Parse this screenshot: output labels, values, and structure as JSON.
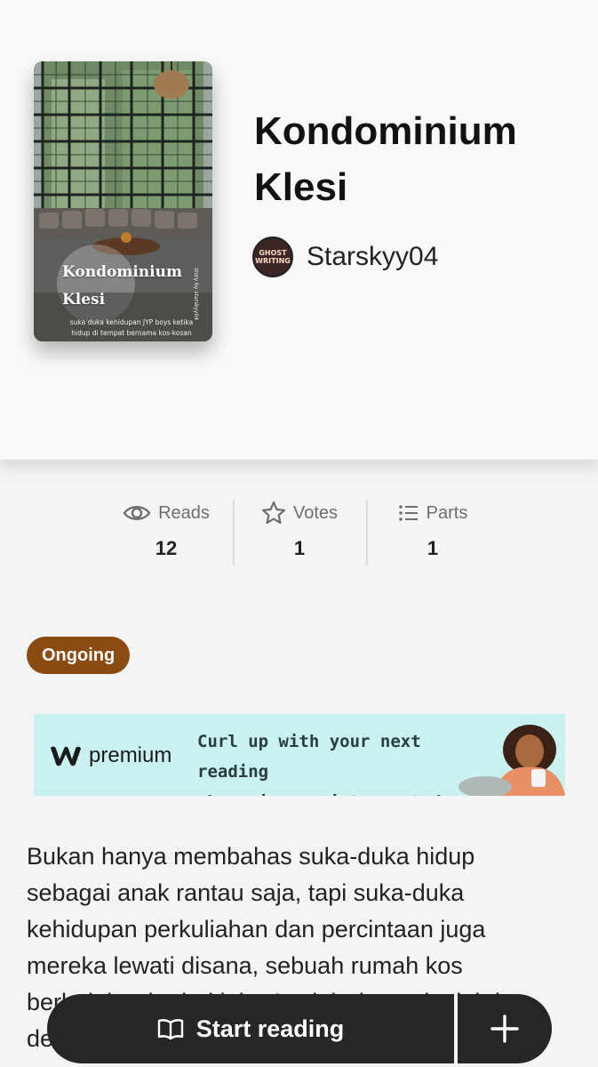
{
  "story": {
    "title": "Kondominium Klesi",
    "author": "Starskyy04",
    "status": "Ongoing",
    "description": "Bukan hanya membahas suka-duka hidup sebagai anak rantau saja, tapi suka-duka kehidupan perkuliahan dan percintaan juga mereka lewati disana, sebuah rumah kos berbaloh ada dari ini... Apalah daan aku ini dan de..."
  },
  "cover": {
    "title": "Kondominium\nKlesi",
    "subtitle": "suka duka kehidupan JYP boys ketika hidup di tempat bernama kos-kosan",
    "vertical_text": "story by starskyy04"
  },
  "avatar": {
    "line1": "GHOST",
    "line2": "WRITING"
  },
  "stats": {
    "reads": {
      "label": "Reads",
      "value": "12",
      "icon": "eye-icon"
    },
    "votes": {
      "label": "Votes",
      "value": "1",
      "icon": "star-icon"
    },
    "parts": {
      "label": "Parts",
      "value": "1",
      "icon": "list-icon"
    }
  },
  "ad": {
    "brand": "premium",
    "text": "Curl up with your next reading\nobsession, uninterrupted."
  },
  "actions": {
    "start_label": "Start reading",
    "add_icon": "plus-icon"
  },
  "colors": {
    "status_badge": "#8b4a10",
    "action_bar": "#262626",
    "ad_background": "#c9f1ef"
  }
}
